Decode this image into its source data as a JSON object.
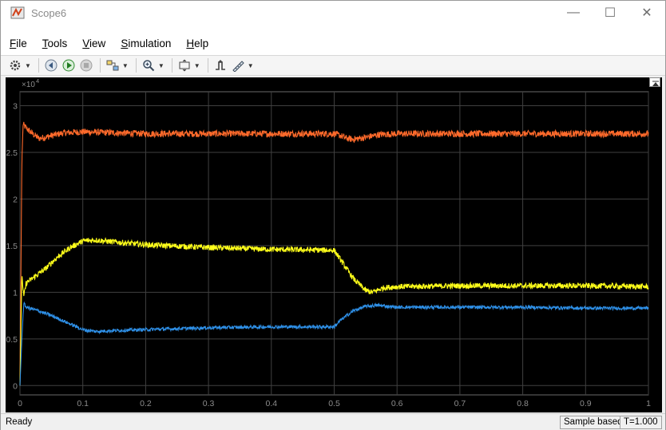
{
  "window": {
    "title": "Scope6",
    "minimize_glyph": "—",
    "maximize_glyph": "☐",
    "close_glyph": "✕"
  },
  "menu": [
    {
      "label": "File",
      "accel": "F",
      "rest": "ile"
    },
    {
      "label": "Tools",
      "accel": "T",
      "rest": "ools"
    },
    {
      "label": "View",
      "accel": "V",
      "rest": "iew"
    },
    {
      "label": "Simulation",
      "accel": "S",
      "rest": "imulation"
    },
    {
      "label": "Help",
      "accel": "H",
      "rest": "elp"
    }
  ],
  "toolbar": {
    "icons": [
      "settings-icon",
      "step-back-icon",
      "run-icon",
      "stop-icon",
      "highlight-icon",
      "zoom-icon",
      "autoscale-icon",
      "triggers-icon",
      "measurements-icon"
    ]
  },
  "status": {
    "left": "Ready",
    "mode": "Sample based",
    "time": "T=1.000"
  },
  "chart_data": {
    "type": "line",
    "title": "",
    "xlabel": "",
    "ylabel": "",
    "exponent_label": "×10",
    "exponent_power": "4",
    "xlim": [
      0,
      1
    ],
    "ylim": [
      -0.1,
      3.15
    ],
    "grid": true,
    "x_ticks": [
      "0",
      "0.1",
      "0.2",
      "0.3",
      "0.4",
      "0.5",
      "0.6",
      "0.7",
      "0.8",
      "0.9",
      "1"
    ],
    "x_tick_values": [
      0,
      0.1,
      0.2,
      0.3,
      0.4,
      0.5,
      0.6,
      0.7,
      0.8,
      0.9,
      1
    ],
    "y_ticks": [
      "0",
      "0.5",
      "1",
      "1.5",
      "2",
      "2.5",
      "3"
    ],
    "y_tick_values": [
      0,
      0.5,
      1,
      1.5,
      2,
      2.5,
      3
    ],
    "background": "#000000",
    "grid_color": "#404040",
    "axis_label_color": "#8c8c8c",
    "series": [
      {
        "color": "#ff6a2b",
        "x": [
          0,
          0.003,
          0.005,
          0.01,
          0.02,
          0.03,
          0.04,
          0.05,
          0.07,
          0.1,
          0.15,
          0.2,
          0.3,
          0.4,
          0.5,
          0.51,
          0.52,
          0.53,
          0.55,
          0.57,
          0.6,
          0.7,
          0.8,
          0.9,
          1.0
        ],
        "y": [
          0,
          2.4,
          2.8,
          2.76,
          2.7,
          2.65,
          2.66,
          2.68,
          2.71,
          2.72,
          2.71,
          2.7,
          2.7,
          2.7,
          2.7,
          2.68,
          2.65,
          2.64,
          2.66,
          2.69,
          2.7,
          2.7,
          2.7,
          2.7,
          2.7
        ],
        "noise": 0.035
      },
      {
        "color": "#ffff1a",
        "x": [
          0,
          0.003,
          0.006,
          0.01,
          0.02,
          0.04,
          0.06,
          0.08,
          0.1,
          0.12,
          0.15,
          0.2,
          0.3,
          0.4,
          0.5,
          0.51,
          0.53,
          0.55,
          0.56,
          0.58,
          0.6,
          0.7,
          0.8,
          0.9,
          1.0
        ],
        "y": [
          0,
          1.2,
          0.95,
          1.1,
          1.15,
          1.25,
          1.38,
          1.48,
          1.55,
          1.56,
          1.54,
          1.51,
          1.48,
          1.46,
          1.45,
          1.35,
          1.15,
          1.02,
          1.0,
          1.05,
          1.06,
          1.07,
          1.07,
          1.07,
          1.06
        ],
        "noise": 0.03
      },
      {
        "color": "#2e8fe6",
        "x": [
          0,
          0.003,
          0.006,
          0.01,
          0.03,
          0.05,
          0.08,
          0.1,
          0.12,
          0.15,
          0.2,
          0.3,
          0.4,
          0.5,
          0.51,
          0.53,
          0.55,
          0.57,
          0.6,
          0.7,
          0.8,
          0.9,
          1.0
        ],
        "y": [
          0,
          0.5,
          0.88,
          0.84,
          0.8,
          0.75,
          0.66,
          0.6,
          0.58,
          0.59,
          0.6,
          0.62,
          0.63,
          0.63,
          0.7,
          0.8,
          0.85,
          0.86,
          0.84,
          0.84,
          0.84,
          0.83,
          0.83
        ],
        "noise": 0.018
      }
    ]
  }
}
